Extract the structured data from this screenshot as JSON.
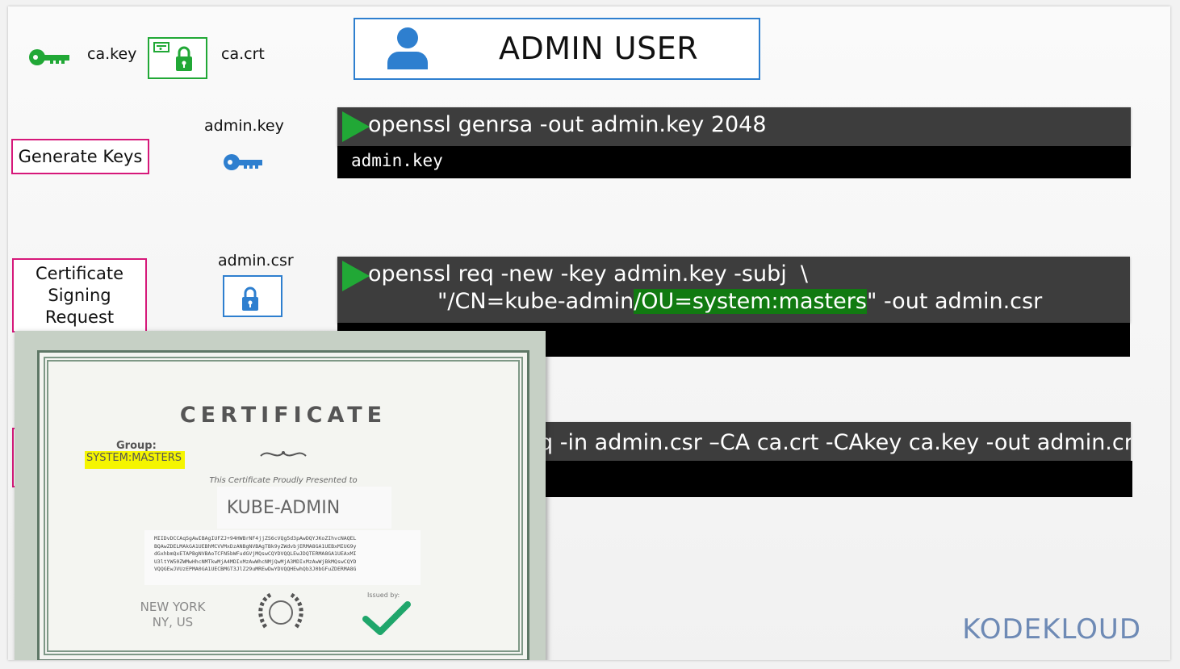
{
  "header": {
    "ca_key_label": "ca.key",
    "ca_crt_label": "ca.crt",
    "title": "ADMIN USER"
  },
  "steps": [
    {
      "label": "Generate Keys",
      "file_label": "admin.key"
    },
    {
      "label": "Certificate Signing Request",
      "file_label": "admin.csr"
    }
  ],
  "terminal1": {
    "command": "openssl genrsa -out admin.key 2048",
    "output": "admin.key"
  },
  "terminal2": {
    "line1": "openssl req -new -key admin.key -subj  \\",
    "line2_prefix": "\"/CN=kube-admin",
    "line2_highlight": "/OU=system:masters",
    "line2_suffix": "\" -out admin.csr"
  },
  "terminal3": {
    "command_partial": "q -in admin.csr –CA ca.crt -CAkey ca.key -out admin.crt"
  },
  "certificate": {
    "title": "CERTIFICATE",
    "group_label": "Group:",
    "group_value": "SYSTEM:MASTERS",
    "presented_text": "This Certificate Proudly Presented to",
    "recipient": "KUBE-ADMIN",
    "key_lines": [
      "MIIDvDCCAqSgAwIBAgIUFZJ+94HWBrNF4jjZS6cVQg5d3pAwDQYJKoZIhvcNAQEL",
      "BQAwZDELMAkGA1UEBhMCVVMxDzANBgNVBAgTBk9yZWdvbjERMA8GA1UEBxMIUG9y",
      "dGxhbmQxETAPBgNVBAoTCFN5bWFudGVjMQswCQYDVQQLEwJDQTERMA8GA1UEAxMI",
      "U3ltYW50ZWMwHhcNMTkwMjA4MDIxMzAwWhcNMjQwMjA3MDIxMzAwWjBkMQswCQYD",
      "VQQGEwJVUzEPMA0GA1UECBMGT3JlZ29uMREwDwYDVQQHEwhQb3J0bGFuZDERMA8G"
    ],
    "location_line1": "NEW YORK",
    "location_line2": "NY, US",
    "issued_by_label": "Issued by:"
  },
  "brand": {
    "name": "KODEKLOUD"
  },
  "colors": {
    "accent_blue": "#2e7fcf",
    "accent_pink": "#d6187a",
    "key_green": "#21a836",
    "key_blue": "#2e7fcf",
    "highlight_green": "#117a11",
    "group_yellow": "#f5f500"
  }
}
